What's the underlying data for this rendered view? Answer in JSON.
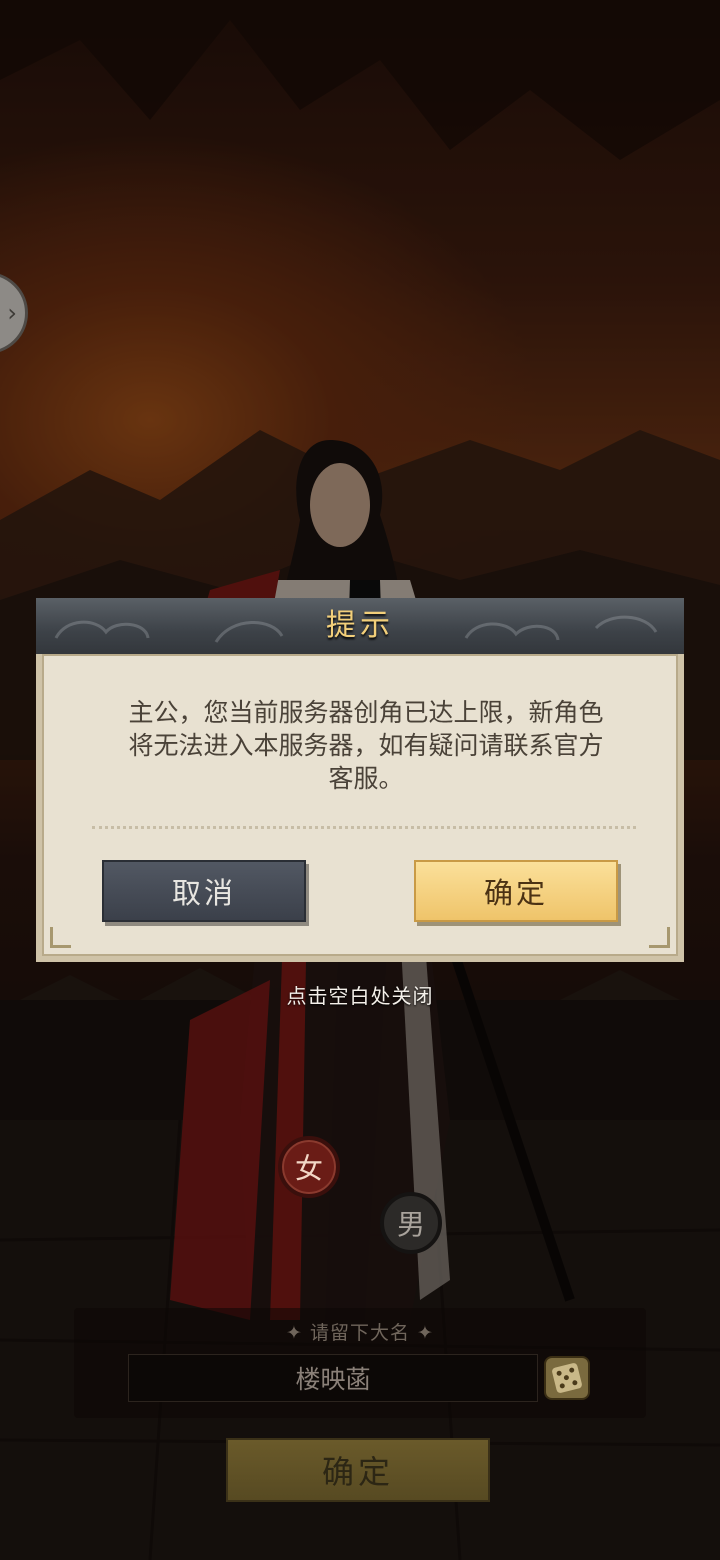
{
  "dialog": {
    "title": "提示",
    "message_line1": "主公，您当前服务器创角已达上限，新角色",
    "message_line2": "将无法进入本服务器，如有疑问请联系官方",
    "message_line3": "客服。",
    "cancel_label": "取消",
    "confirm_label": "确定"
  },
  "close_hint": "点击空白处关闭",
  "gender": {
    "female_label": "女",
    "male_label": "男"
  },
  "name_entry": {
    "hint": "✦ 请留下大名 ✦",
    "value": "楼映菡"
  },
  "bottom_confirm_label": "确定",
  "side_tab_icon": "chevron-right-icon",
  "colors": {
    "title_gold": "#f2cf7a",
    "confirm_gold": "#efc46a",
    "cancel_slate": "#3b404a"
  }
}
